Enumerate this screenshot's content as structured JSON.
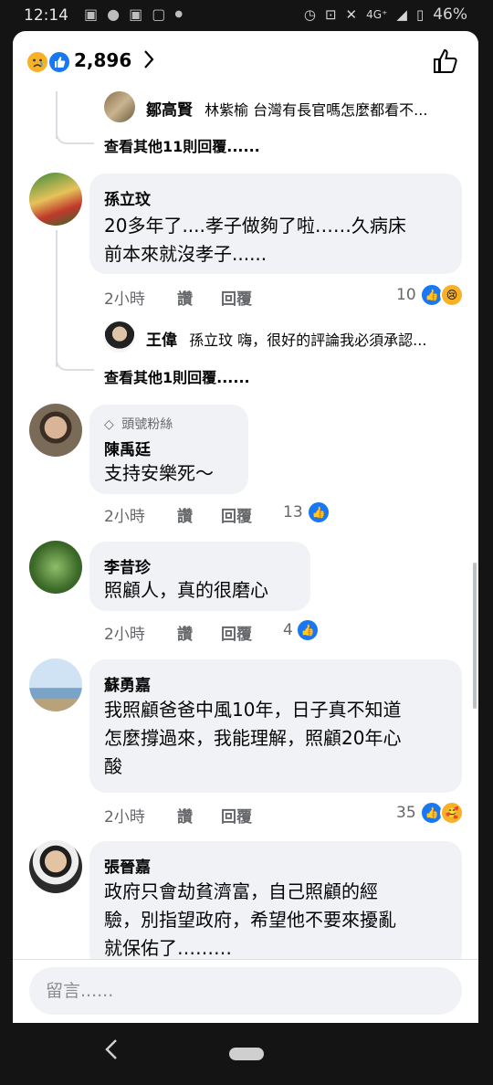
{
  "status_bar": {
    "time": "12:14",
    "network": "4G⁺",
    "battery": "46%"
  },
  "header": {
    "reaction_count": "2,896",
    "icons": [
      "sad-icon",
      "like-icon",
      "chevron-right-icon",
      "thumbs-up-icon"
    ]
  },
  "threads": [
    {
      "reply_preview": {
        "name": "鄒高賢",
        "text": "林紫榆  台灣有長官嗎怎麼都看不..."
      },
      "view_more": "查看其他11則回覆......"
    }
  ],
  "comments": [
    {
      "name": "孫立玟",
      "text_lines": [
        "20多年了....孝子做夠了啦……久病床",
        "前本來就沒孝子......"
      ],
      "time": "2小時",
      "like": "讚",
      "reply": "回覆",
      "reaction_count": "10",
      "reply_preview": {
        "name": "王偉",
        "text": "孫立玟 嗨，很好的評論我必須承認..."
      },
      "view_more": "查看其他1則回覆......"
    },
    {
      "badge": "頭號粉絲",
      "name": "陳禹廷",
      "text_lines": [
        "支持安樂死～"
      ],
      "time": "2小時",
      "like": "讚",
      "reply": "回覆",
      "reaction_count": "13"
    },
    {
      "name": "李昔珍",
      "text_lines": [
        "照顧人，真的很磨心"
      ],
      "time": "2小時",
      "like": "讚",
      "reply": "回覆",
      "reaction_count": "4"
    },
    {
      "name": "蘇勇嘉",
      "text_lines": [
        "我照顧爸爸中風10年，日子真不知道",
        "怎麼撐過來，我能理解，照顧20年心",
        "酸"
      ],
      "time": "2小時",
      "like": "讚",
      "reply": "回覆",
      "reaction_count": "35"
    },
    {
      "name": "張晉嘉",
      "text_lines": [
        "政府只會劫貧濟富，自己照顧的經",
        "驗，別指望政府，希望他不要來擾亂",
        "就保佑了………"
      ]
    }
  ],
  "composer": {
    "placeholder": "留言......"
  },
  "colors": {
    "like_blue": "#1877f2",
    "bubble_gray": "#f0f2f5",
    "meta_gray": "#65676b"
  }
}
